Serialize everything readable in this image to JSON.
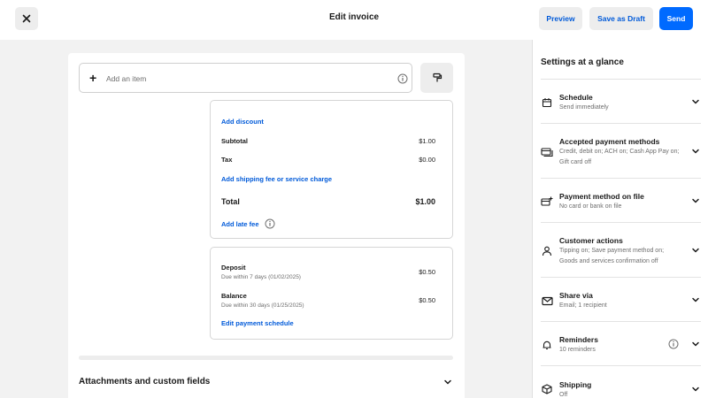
{
  "header": {
    "title": "Edit invoice",
    "preview_label": "Preview",
    "draft_label": "Save as Draft",
    "send_label": "Send"
  },
  "item_entry": {
    "placeholder": "Add an item"
  },
  "totals": {
    "add_discount": "Add discount",
    "subtotal_label": "Subtotal",
    "subtotal_value": "$1.00",
    "tax_label": "Tax",
    "tax_value": "$0.00",
    "add_shipping": "Add shipping fee or service charge",
    "total_label": "Total",
    "total_value": "$1.00",
    "add_late_fee": "Add late fee"
  },
  "payments": {
    "deposit_label": "Deposit",
    "deposit_due": "Due within 7 days (01/02/2025)",
    "deposit_value": "$0.50",
    "balance_label": "Balance",
    "balance_due": "Due within 30 days (01/25/2025)",
    "balance_value": "$0.50",
    "edit_schedule": "Edit payment schedule"
  },
  "attachments": {
    "label": "Attachments and custom fields"
  },
  "sidebar": {
    "title": "Settings at a glance",
    "items": [
      {
        "label": "Schedule",
        "desc": "Send immediately",
        "icon": "calendar-icon"
      },
      {
        "label": "Accepted payment methods",
        "desc": "Credit, debit on; ACH on; Cash App Pay on; Gift card off",
        "icon": "credit-cards-icon"
      },
      {
        "label": "Payment method on file",
        "desc": "No card or bank on file",
        "icon": "card-add-icon"
      },
      {
        "label": "Customer actions",
        "desc": "Tipping on; Save payment method on; Goods and services confirmation off",
        "icon": "person-icon"
      },
      {
        "label": "Share via",
        "desc": "Email; 1 recipient",
        "icon": "envelope-icon"
      },
      {
        "label": "Reminders",
        "desc": "10 reminders",
        "icon": "bell-icon"
      },
      {
        "label": "Shipping",
        "desc": "Off",
        "icon": "box-icon"
      }
    ]
  }
}
